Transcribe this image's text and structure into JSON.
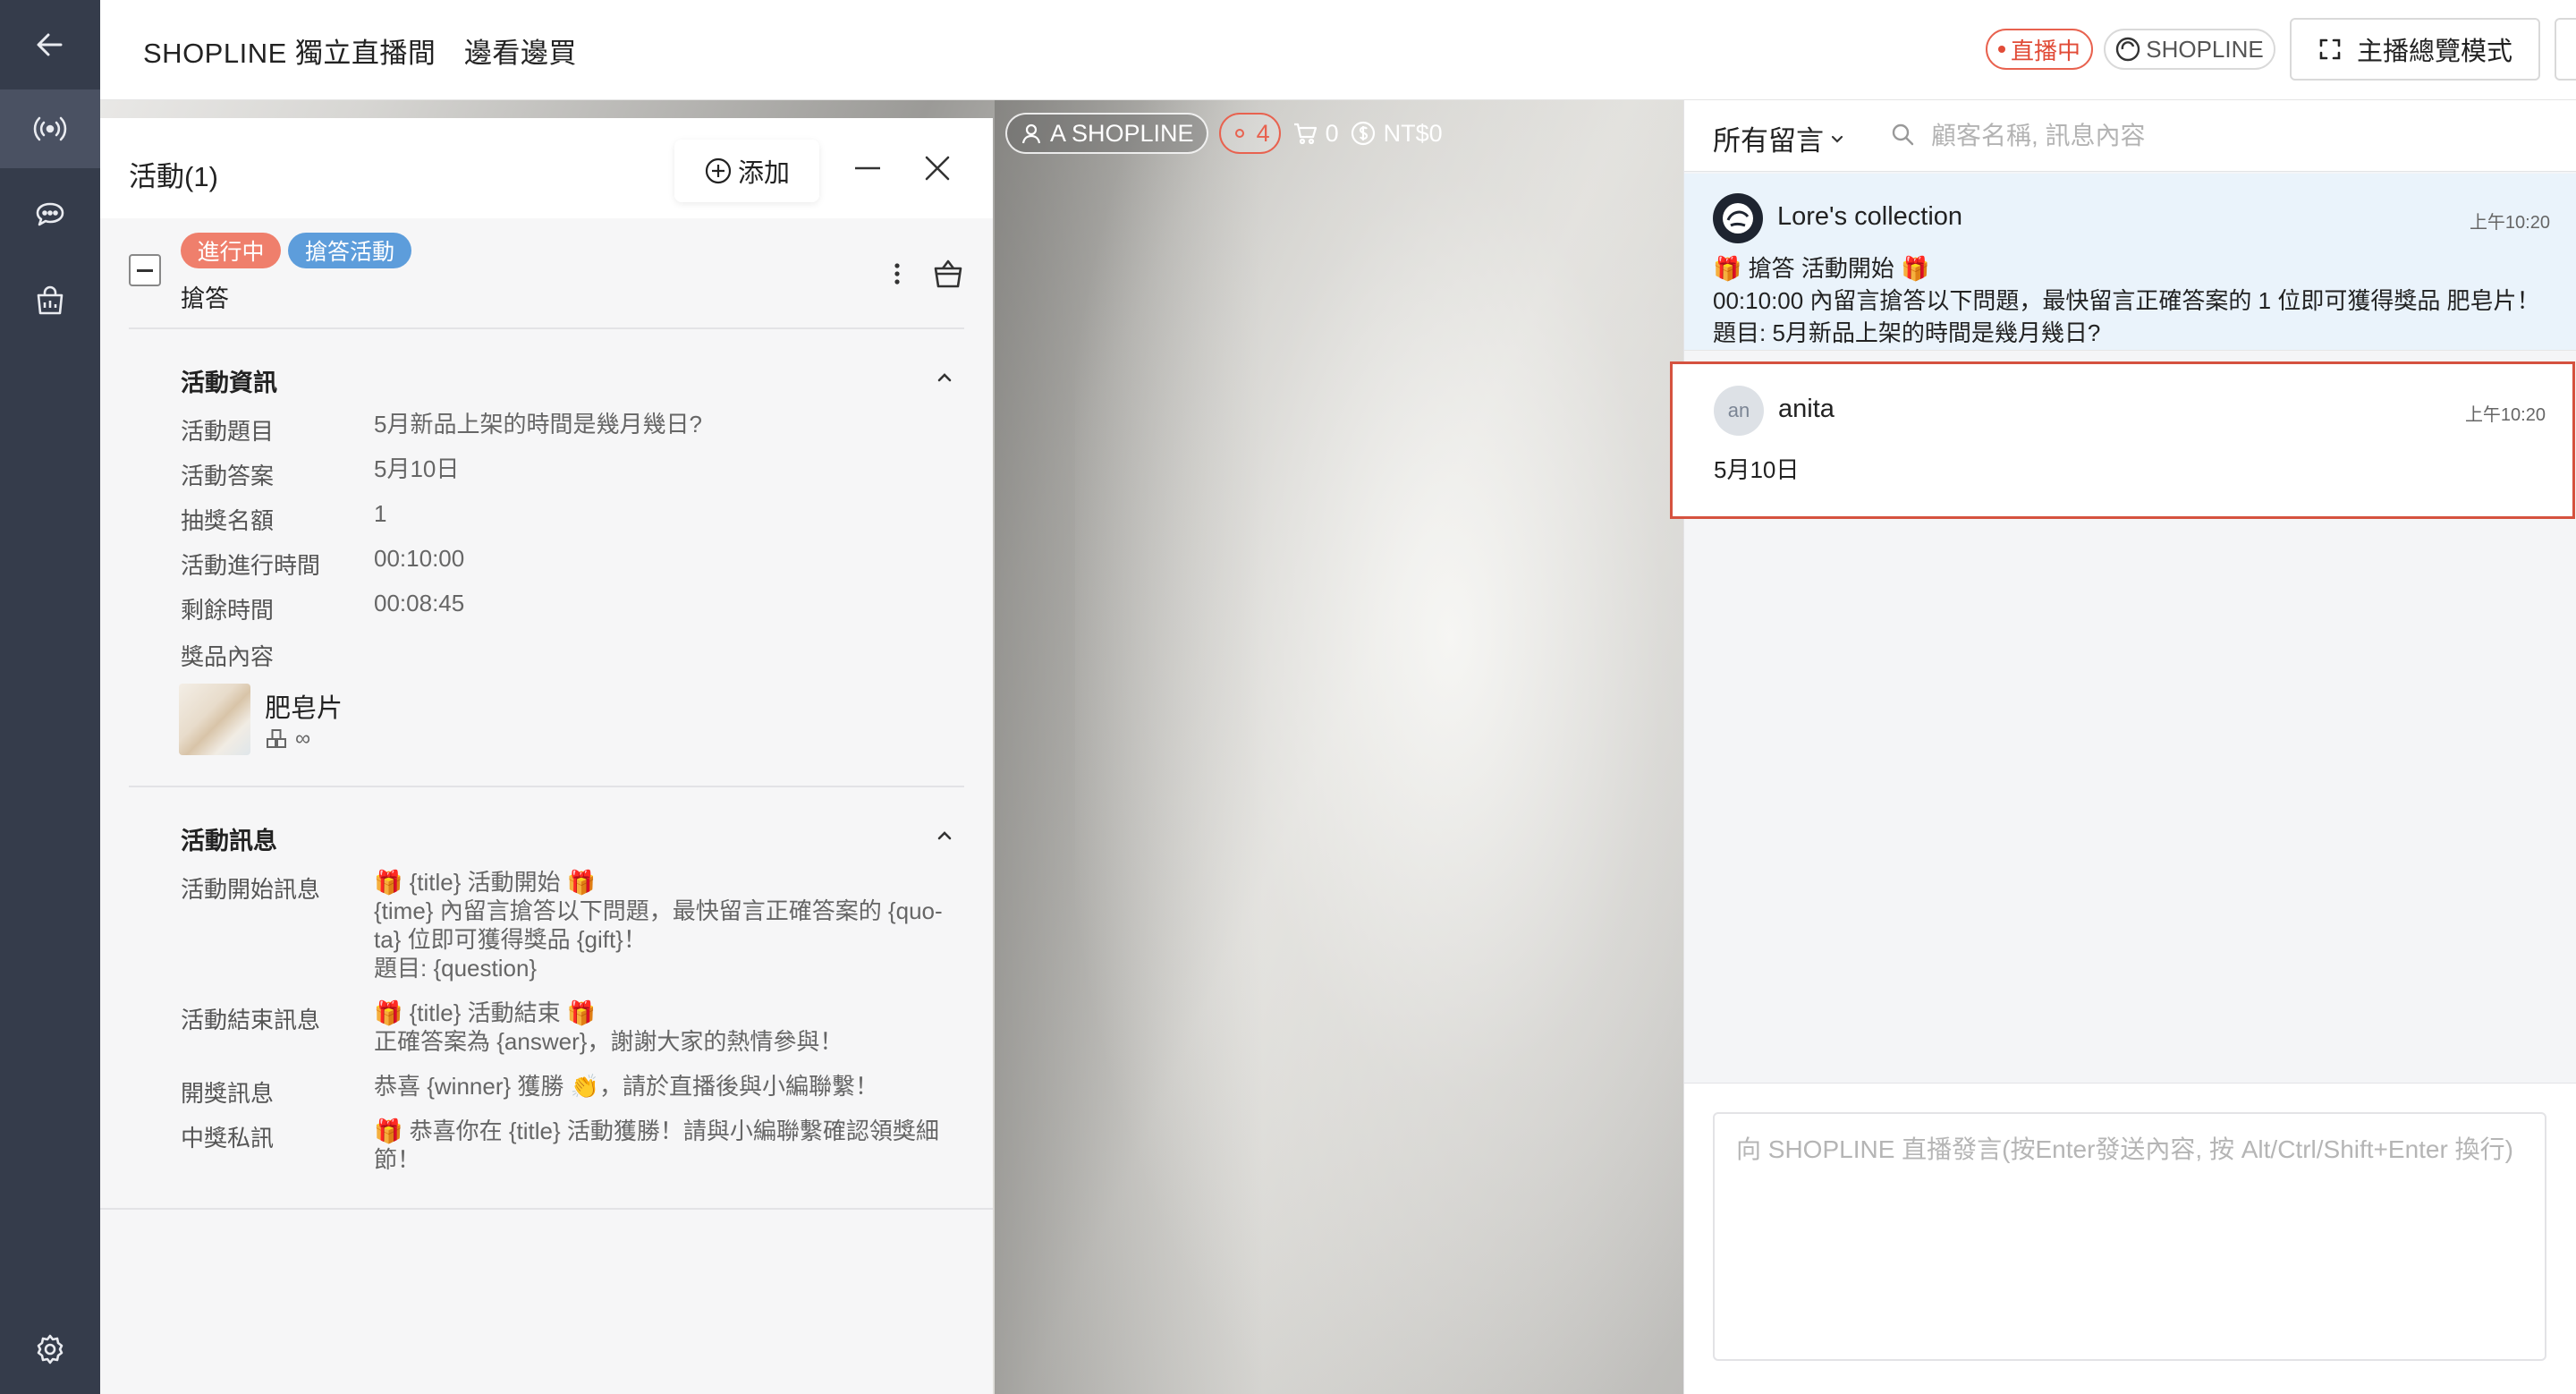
{
  "header": {
    "title": "SHOPLINE 獨立直播間　邊看邊買",
    "live_badge": "直播中",
    "shop_badge": "SHOPLINE",
    "host_mode_button": "主播總覽模式"
  },
  "sidebar": {
    "items": [
      {
        "name": "back",
        "icon": "arrow-left-icon"
      },
      {
        "name": "live",
        "icon": "broadcast-icon"
      },
      {
        "name": "chat",
        "icon": "chat-bubble-icon"
      },
      {
        "name": "shop",
        "icon": "shopping-bag-icon"
      },
      {
        "name": "settings",
        "icon": "gear-icon"
      }
    ]
  },
  "video_stats": {
    "account": "A SHOPLINE",
    "viewers": "4",
    "cart": "0",
    "sales": "NT$0"
  },
  "activity_panel": {
    "title": "活動(1)",
    "add_button": "添加",
    "activity": {
      "status_tag": "進行中",
      "type_tag": "搶答活動",
      "name": "搶答"
    },
    "info_section": {
      "title": "活動資訊",
      "rows": [
        {
          "label": "活動題目",
          "value": "5月新品上架的時間是幾月幾日?"
        },
        {
          "label": "活動答案",
          "value": "5月10日"
        },
        {
          "label": "抽獎名額",
          "value": "1"
        },
        {
          "label": "活動進行時間",
          "value": "00:10:00"
        },
        {
          "label": "剩餘時間",
          "value": "00:08:45"
        },
        {
          "label": "獎品內容",
          "value": ""
        }
      ],
      "prize": {
        "name": "肥皂片",
        "stock": "∞"
      }
    },
    "message_section": {
      "title": "活動訊息",
      "rows": [
        {
          "label": "活動開始訊息",
          "value": "🎁 {title} 活動開始 🎁\n{time} 內留言搶答以下問題，最快留言正確答案的 {quo-\nta} 位即可獲得獎品 {gift}！\n題目: {question}"
        },
        {
          "label": "活動結束訊息",
          "value": "🎁 {title} 活動結束 🎁\n正確答案為 {answer}，謝謝大家的熱情參與！"
        },
        {
          "label": "開獎訊息",
          "value": "恭喜 {winner} 獲勝 👏，請於直播後與小編聯繫！"
        },
        {
          "label": "中獎私訊",
          "value": "🎁 恭喜你在 {title} 活動獲勝！請與小編聯繫確認領獎細\n節！"
        }
      ]
    }
  },
  "comments": {
    "filter_label": "所有留言",
    "search_placeholder": "顧客名稱, 訊息內容",
    "messages": [
      {
        "author": "Lore's collection",
        "time": "上午10:20",
        "lines": [
          "🎁 搶答 活動開始 🎁",
          "00:10:00 內留言搶答以下問題，最快留言正確答案的 1 位即可獲得獎品 肥皂片！",
          "題目: 5月新品上架的時間是幾月幾日?"
        ]
      },
      {
        "author": "anita",
        "avatar_initials": "an",
        "time": "上午10:20",
        "lines": [
          "5月10日"
        ]
      }
    ],
    "input_placeholder": "向 SHOPLINE 直播發言(按Enter發送內容, 按 Alt/Ctrl/Shift+Enter 換行)"
  },
  "colors": {
    "sidebar_bg": "#353c4b",
    "live_red": "#e14b37",
    "tag_live": "#ef7f6c",
    "tag_type": "#5d9ddb",
    "highlight_border": "#d5523f",
    "host_msg_bg": "#eaf3fb"
  }
}
